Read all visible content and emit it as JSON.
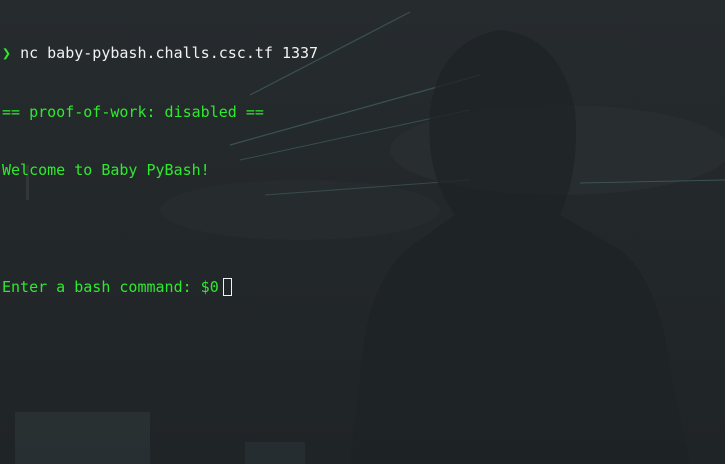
{
  "terminal": {
    "prompt_symbol": "❯",
    "command": "nc baby-pybash.challs.csc.tf 1337",
    "output_lines": [
      "== proof-of-work: disabled ==",
      "Welcome to Baby PyBash!",
      ""
    ],
    "input_prompt": "Enter a bash command: $0",
    "colors": {
      "output": "#2eea2e",
      "command": "#f2f2f2",
      "background": "#23272a"
    }
  }
}
